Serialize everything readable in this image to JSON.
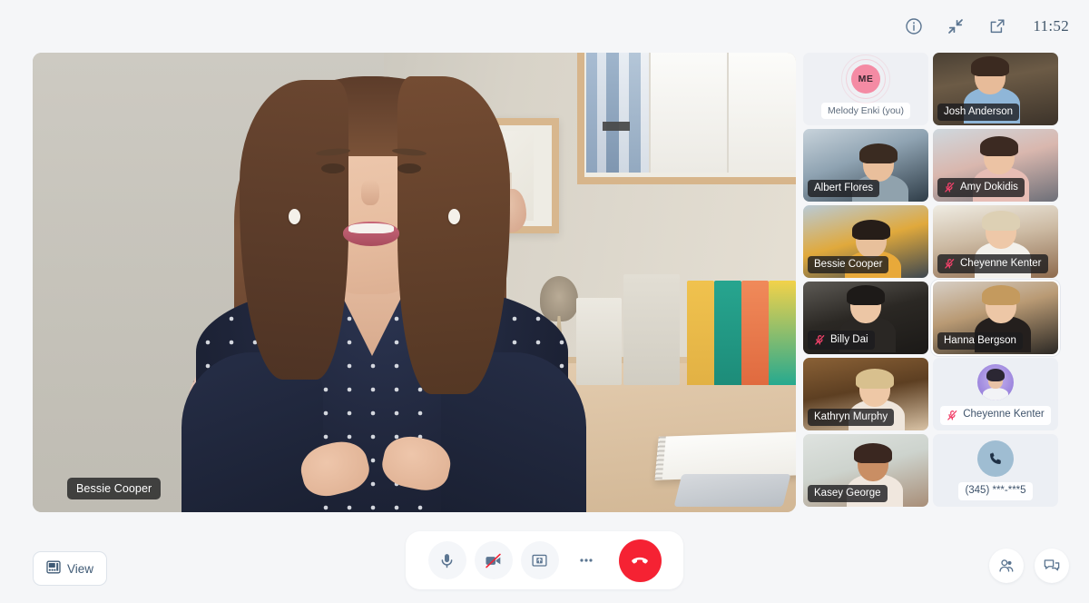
{
  "topbar": {
    "info_icon": "info-circle-icon",
    "collapse_icon": "collapse-arrows-icon",
    "popout_icon": "external-link-icon",
    "time": "11:52"
  },
  "stage": {
    "speaker_name": "Bessie Cooper"
  },
  "rail": {
    "participants": [
      {
        "name": "Melody Enki (you)",
        "type": "self",
        "initials": "ME",
        "muted": false,
        "speaking": true,
        "label_style": "light",
        "accent": "#f48ba4"
      },
      {
        "name": "Josh Anderson",
        "type": "video",
        "muted": false,
        "speaking": false,
        "label_style": "dark"
      },
      {
        "name": "Albert Flores",
        "type": "video",
        "muted": false,
        "speaking": false,
        "label_style": "dark"
      },
      {
        "name": "Amy Dokidis",
        "type": "video",
        "muted": true,
        "speaking": false,
        "label_style": "dark"
      },
      {
        "name": "Bessie Cooper",
        "type": "video",
        "muted": false,
        "speaking": false,
        "label_style": "dark"
      },
      {
        "name": "Cheyenne Kenter",
        "type": "video",
        "muted": true,
        "speaking": false,
        "label_style": "dark"
      },
      {
        "name": "Billy Dai",
        "type": "video",
        "muted": true,
        "speaking": false,
        "label_style": "dark"
      },
      {
        "name": "Hanna Bergson",
        "type": "video",
        "muted": false,
        "speaking": true,
        "label_style": "dark"
      },
      {
        "name": "Kathryn Murphy",
        "type": "video",
        "muted": false,
        "speaking": false,
        "label_style": "dark"
      },
      {
        "name": "Cheyenne Kenter",
        "type": "avatar",
        "muted": true,
        "speaking": false,
        "label_style": "light"
      },
      {
        "name": "Kasey George",
        "type": "video",
        "muted": false,
        "speaking": false,
        "label_style": "dark"
      },
      {
        "name": "(345) ***-***5",
        "type": "phone",
        "muted": false,
        "speaking": false,
        "label_style": "light"
      }
    ]
  },
  "footer": {
    "view_label": "View",
    "view_icon": "layout-grid-icon",
    "controls": [
      {
        "name": "microphone-button",
        "icon": "microphone-icon",
        "state": "on"
      },
      {
        "name": "camera-button",
        "icon": "camera-off-icon",
        "state": "off"
      },
      {
        "name": "share-screen-button",
        "icon": "share-screen-icon",
        "state": "on"
      },
      {
        "name": "more-options-button",
        "icon": "ellipsis-icon",
        "state": "on"
      },
      {
        "name": "hangup-button",
        "icon": "phone-hangup-icon",
        "state": "on"
      }
    ],
    "participants_icon": "participants-icon",
    "chat_icon": "chat-icon"
  },
  "colors": {
    "page_bg": "#f5f6f8",
    "accent_red": "#f52233",
    "accent_pink": "#f48ba4",
    "icon_blue": "#5b7591",
    "label_dark": "rgba(28,28,30,.80)"
  }
}
